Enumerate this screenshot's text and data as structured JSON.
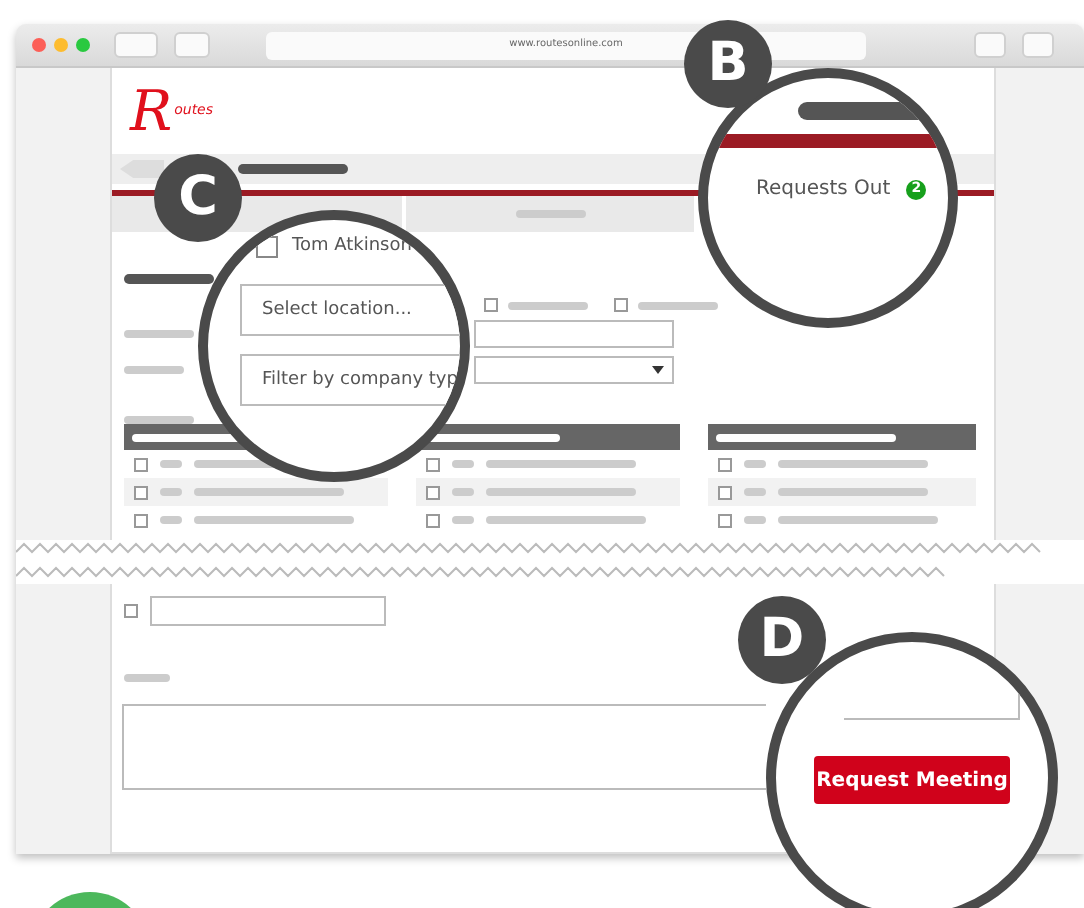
{
  "browser": {
    "url": "www.routesonline.com"
  },
  "logo": {
    "initial": "R",
    "rest": "outes"
  },
  "callout_b": {
    "letter": "B",
    "tab_label": "Requests Out",
    "badge": "2"
  },
  "callout_c": {
    "letter": "C",
    "checkbox": {
      "label": "Tom Atkinson",
      "checked": false
    },
    "location_field": {
      "placeholder": "Select location..."
    },
    "company_filter": {
      "placeholder": "Filter by company typ"
    }
  },
  "callout_d": {
    "letter": "D",
    "button": "Request Meeting"
  },
  "filter_options": [
    {
      "checked": false
    },
    {
      "checked": false
    }
  ],
  "tables": [
    {
      "rows": [
        {
          "checked": false
        },
        {
          "checked": false
        },
        {
          "checked": false
        }
      ]
    },
    {
      "rows": [
        {
          "checked": false
        },
        {
          "checked": false
        },
        {
          "checked": false
        }
      ]
    },
    {
      "rows": [
        {
          "checked": false
        },
        {
          "checked": false
        },
        {
          "checked": false
        }
      ]
    }
  ],
  "bottom_checkbox": {
    "checked": false
  }
}
